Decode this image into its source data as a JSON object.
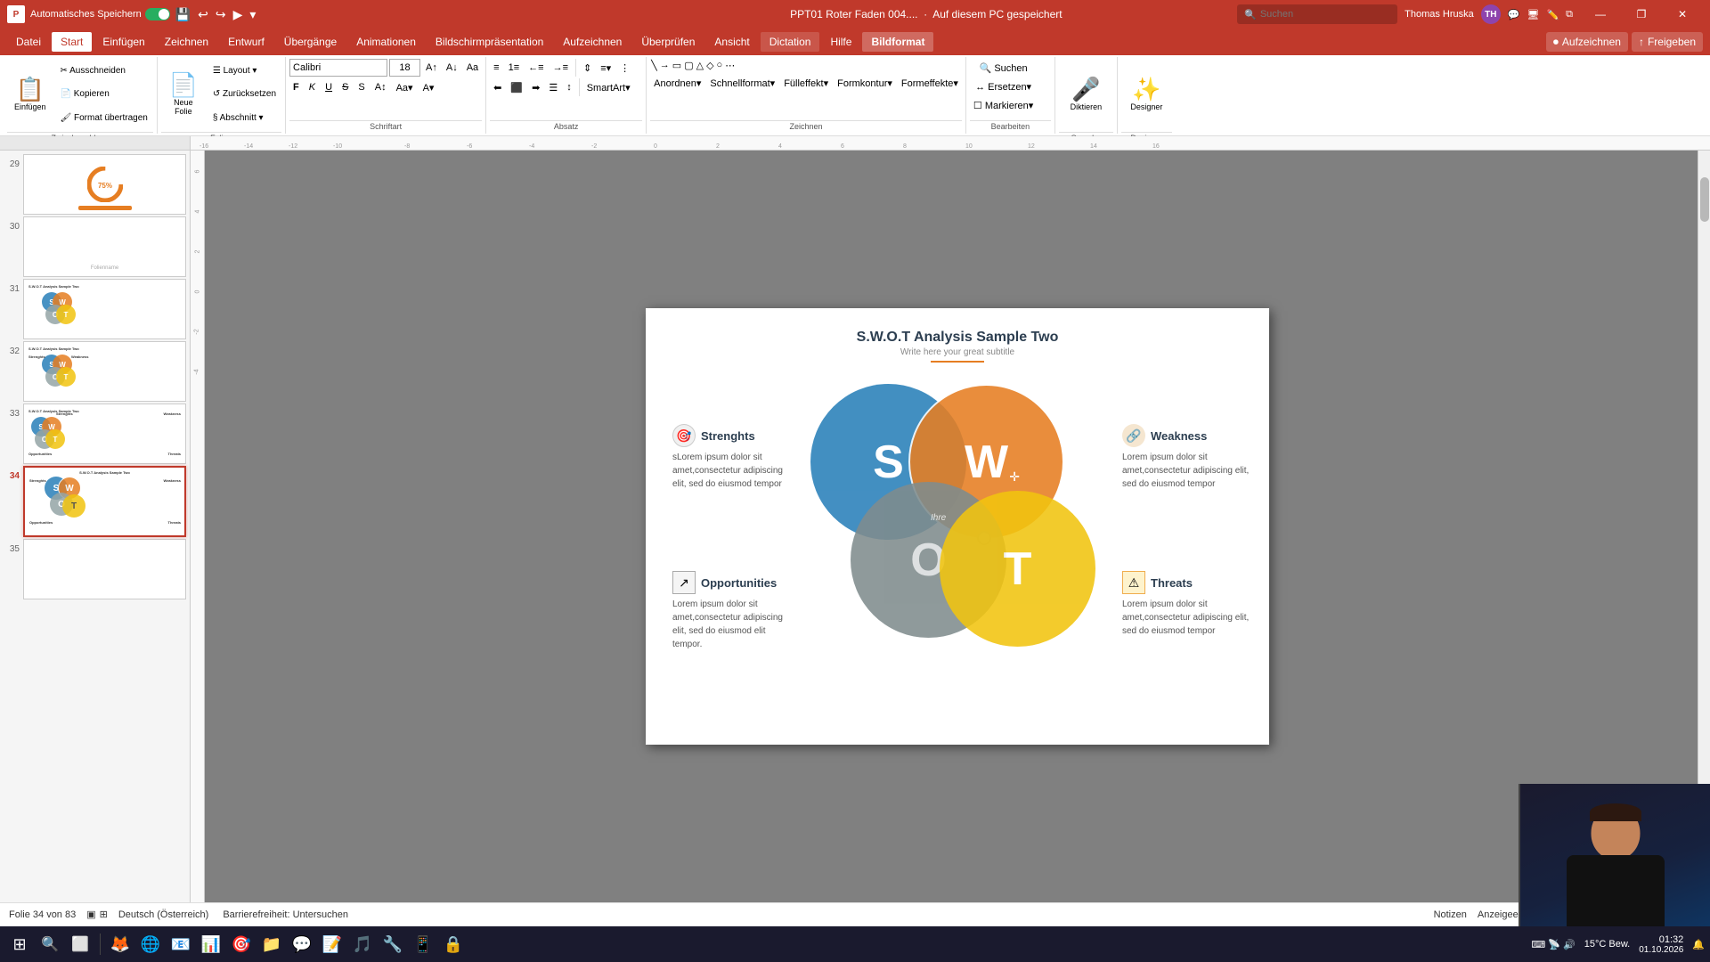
{
  "titlebar": {
    "autosave": "Automatisches Speichern",
    "filename": "PPT01 Roter Faden 004....",
    "saved_status": "Auf diesem PC gespeichert",
    "user": "Thomas Hruska",
    "user_initials": "TH",
    "search_placeholder": "Suchen",
    "minimize": "—",
    "restore": "❐",
    "close": "✕"
  },
  "menu": {
    "items": [
      "Datei",
      "Start",
      "Einfügen",
      "Zeichnen",
      "Entwurf",
      "Übergänge",
      "Animationen",
      "Bildschirmpräsentation",
      "Aufzeichnen",
      "Überprüfen",
      "Ansicht",
      "Dictation",
      "Hilfe",
      "Bildformat"
    ]
  },
  "ribbon": {
    "groups": {
      "zwischenablage": {
        "label": "Zwischenablage",
        "buttons": [
          "Einfügen",
          "Ausschneiden",
          "Kopieren",
          "Format übertragen"
        ]
      },
      "folien": {
        "label": "Folien",
        "buttons": [
          "Neue Folie",
          "Layout",
          "Zurücksetzen",
          "Abschnitt"
        ]
      },
      "schriftart": {
        "label": "Schriftart",
        "font_name": "Calibri",
        "font_size": "18",
        "bold": "F",
        "italic": "K",
        "underline": "U",
        "strikethrough": "S"
      },
      "absatz": {
        "label": "Absatz"
      },
      "zeichnen": {
        "label": "Zeichnen"
      },
      "bearbeiten": {
        "label": "Bearbeiten",
        "buttons": [
          "Suchen",
          "Ersetzen",
          "Markieren"
        ]
      },
      "sprache": {
        "label": "Sprache",
        "diktieren_label": "Diktieren"
      },
      "designer": {
        "label": "Designer",
        "designer_label": "Designer"
      }
    }
  },
  "slide_panel": {
    "slides": [
      {
        "num": 29,
        "type": "chart"
      },
      {
        "num": 30,
        "type": "blank"
      },
      {
        "num": 31,
        "type": "swot_simple"
      },
      {
        "num": 32,
        "type": "swot_color"
      },
      {
        "num": 33,
        "type": "swot_labeled"
      },
      {
        "num": 34,
        "type": "swot_main",
        "active": true
      },
      {
        "num": 35,
        "type": "empty"
      }
    ]
  },
  "main_slide": {
    "title": "S.W.O.T Analysis Sample Two",
    "subtitle": "Write here your great subtitle",
    "swot": {
      "S": {
        "letter": "S",
        "color": "#2980b9",
        "label": "Strenghts"
      },
      "W": {
        "letter": "W",
        "color": "#e67e22",
        "label": "Weakness"
      },
      "O": {
        "letter": "O",
        "color": "#95a5a6",
        "label": "Opportunities"
      },
      "T": {
        "letter": "T",
        "color": "#f1c40f",
        "label": "Threats"
      }
    },
    "labels": {
      "strengths": {
        "title": "Strenghts",
        "text": "sLorem ipsum dolor sit amet,consectetur adipiscing elit, sed do eiusmod tempor"
      },
      "weakness": {
        "title": "Weakness",
        "text": "Lorem ipsum dolor sit amet,consectetur adipiscing elit, sed do eiusmod tempor"
      },
      "opportunities": {
        "title": "Opportunities",
        "text": "Lorem ipsum dolor sit amet,consectetur adipiscing elit, sed do eiusmod elit tempor."
      },
      "threats": {
        "title": "Threats",
        "text": "Lorem ipsum dolor sit amet,consectetur adipiscing elit, sed do eiusmod tempor"
      }
    }
  },
  "statusbar": {
    "slide_info": "Folie 34 von 83",
    "language": "Deutsch (Österreich)",
    "accessibility": "Barrierefreiheit: Untersuchen",
    "notes": "Notizen",
    "slide_settings": "Anzeigeeinstellungen",
    "zoom": "15°C Bew."
  },
  "taskbar": {
    "icons": [
      "⊞",
      "🔍",
      "⬜"
    ],
    "apps": [
      "🦊",
      "🌐",
      "📧",
      "📊",
      "🎯",
      "📁",
      "🔵",
      "📝",
      "🎵",
      "🔧",
      "📱",
      "🔒"
    ],
    "weather": "15°C Bew."
  }
}
